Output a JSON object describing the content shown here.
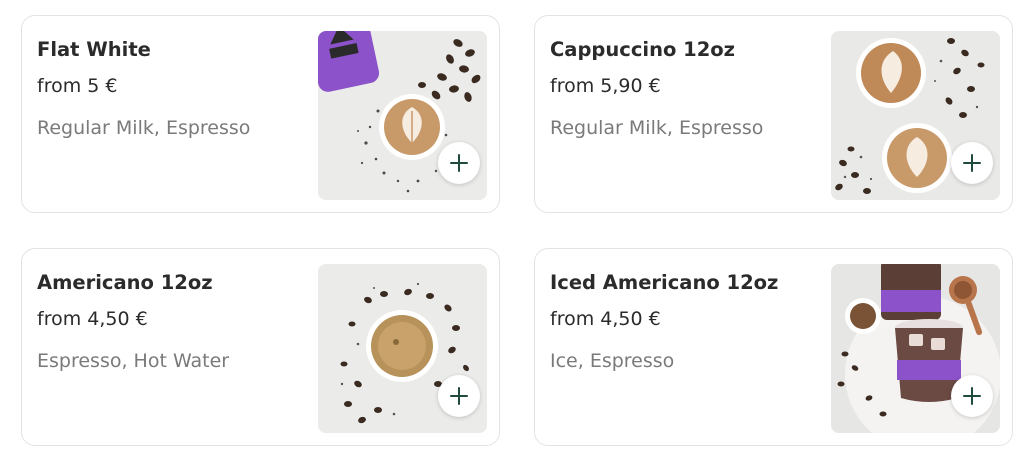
{
  "menu": {
    "items": [
      {
        "name": "Flat White",
        "price": "from 5 €",
        "description": "Regular Milk, Espresso",
        "image": "flat-white-photo"
      },
      {
        "name": "Cappuccino 12oz",
        "price": "from 5,90 €",
        "description": "Regular Milk, Espresso",
        "image": "cappuccino-photo"
      },
      {
        "name": "Americano 12oz",
        "price": "from 4,50 €",
        "description": "Espresso, Hot Water",
        "image": "americano-photo"
      },
      {
        "name": "Iced Americano 12oz",
        "price": "from 4,50 €",
        "description": "Ice, Espresso",
        "image": "iced-americano-photo"
      }
    ],
    "add_icon": "plus-icon",
    "colors": {
      "accent": "#1f4a3d",
      "card_border": "#e3e3e3",
      "description_text": "#7a7a7a",
      "title_text": "#2b2b2b",
      "brand_purple": "#8b52c9"
    }
  }
}
